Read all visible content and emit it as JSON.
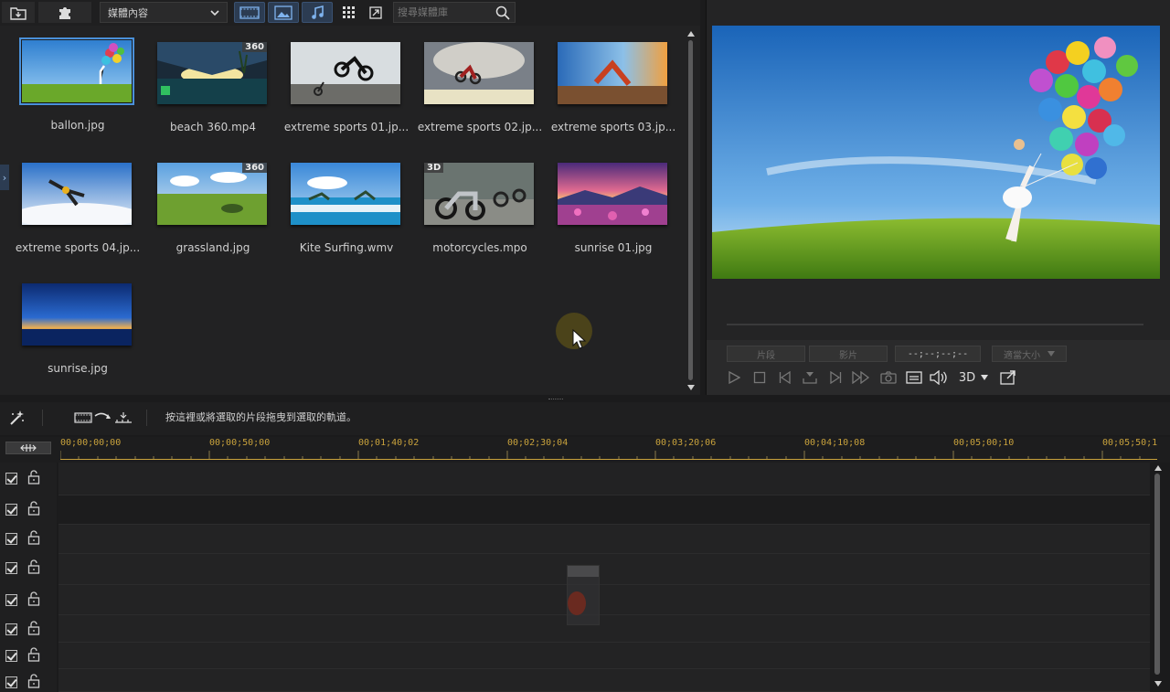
{
  "toolbar": {
    "import_icon": "import-folder-icon",
    "plugin_icon": "puzzle-plugin-icon",
    "room_dropdown": "媒體內容",
    "view_buttons": [
      "video-filter-icon",
      "image-filter-icon",
      "audio-filter-icon",
      "grid-view-icon",
      "expand-icon"
    ],
    "search_placeholder": "搜尋媒體庫"
  },
  "library": {
    "items": [
      {
        "name": "ballon.jpg",
        "badge": ""
      },
      {
        "name": "beach 360.mp4",
        "badge": "360"
      },
      {
        "name": "extreme sports 01.jp...",
        "badge": ""
      },
      {
        "name": "extreme sports 02.jp...",
        "badge": ""
      },
      {
        "name": "extreme sports 03.jp...",
        "badge": ""
      },
      {
        "name": "extreme sports 04.jp...",
        "badge": ""
      },
      {
        "name": "grassland.jpg",
        "badge": "360"
      },
      {
        "name": "Kite Surfing.wmv",
        "badge": ""
      },
      {
        "name": "motorcycles.mpo",
        "badge": "3D"
      },
      {
        "name": "sunrise 01.jpg",
        "badge": ""
      },
      {
        "name": "sunrise.jpg",
        "badge": ""
      }
    ],
    "selected_index": 0
  },
  "preview": {
    "clip_label": "片段",
    "movie_label": "影片",
    "timecode": "--;--;--;--",
    "size_label": "適當大小",
    "three_d_label": "3D"
  },
  "timeline": {
    "hint": "按這裡或將選取的片段拖曳到選取的軌道。",
    "ticks": [
      "00;00;00;00",
      "00;00;50;00",
      "00;01;40;02",
      "00;02;30;04",
      "00;03;20;06",
      "00;04;10;08",
      "00;05;00;10",
      "00;05;50;1"
    ],
    "track_count": 8
  },
  "colors": {
    "accent": "#4a90d9",
    "ruler_text": "#c9a23c"
  }
}
